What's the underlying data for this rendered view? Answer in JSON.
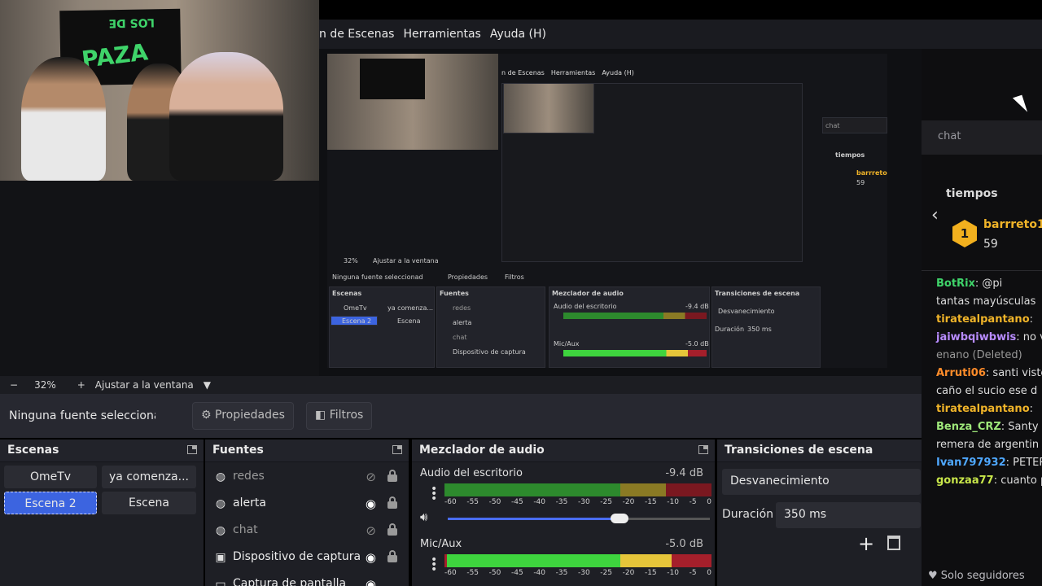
{
  "menu": {
    "items": [
      "n de Escenas",
      "Herramientas",
      "Ayuda (H)"
    ]
  },
  "webcam": {
    "banner_top": "LOS DE",
    "banner_bottom": "PAZA"
  },
  "inner": {
    "menu": [
      "n de Escenas",
      "Herramientas",
      "Ayuda (H)"
    ],
    "zoom": "32%",
    "fit": "Ajustar a la ventana",
    "nosel": "Ninguna fuente seleccionad",
    "props": "Propiedades",
    "filters": "Filtros",
    "scenes_title": "Escenas",
    "sources_title": "Fuentes",
    "mixer_title": "Mezclador de audio",
    "trans_title": "Transiciones de escena",
    "scene_a": "OmeTv",
    "scene_b": "ya comenza...",
    "scene_c": "Escena 2",
    "scene_d": "Escena",
    "src_1": "redes",
    "src_2": "alerta",
    "src_3": "chat",
    "src_4": "Dispositivo de captura",
    "src_5": "Captura de pantalla",
    "mix_1": "Audio del escritorio",
    "mix_1_db": "-9.4 dB",
    "mix_2": "Mic/Aux",
    "mix_2_db": "-5.0 dB",
    "trans": "Desvanecimiento",
    "dur_label": "Duración",
    "dur": "350 ms",
    "chat_input": "chat",
    "tiempos": "tiempos",
    "user": "barrreto1",
    "pts": "59"
  },
  "toolbar": {
    "minus": "−",
    "zoom": "32%",
    "plus": "+",
    "fit": "Ajustar a la ventana",
    "dropdown": "▼"
  },
  "props_bar": {
    "no_selection": "Ninguna fuente seleccionad",
    "properties": "Propiedades",
    "filters": "Filtros"
  },
  "scenes": {
    "title": "Escenas",
    "items": [
      "OmeTv",
      "ya comenza...",
      "Escena 2",
      "Escena"
    ]
  },
  "sources": {
    "title": "Fuentes",
    "items": [
      {
        "label": "redes",
        "icon": "globe-icon"
      },
      {
        "label": "alerta",
        "icon": "globe-icon"
      },
      {
        "label": "chat",
        "icon": "globe-icon"
      },
      {
        "label": "Dispositivo de captura",
        "icon": "camera-icon"
      },
      {
        "label": "Captura de pantalla",
        "icon": "monitor-icon"
      }
    ]
  },
  "mixer": {
    "title": "Mezclador de audio",
    "channels": [
      {
        "name": "Audio del escritorio",
        "db": "-9.4 dB",
        "level": 0.85,
        "volume": 0.66
      },
      {
        "name": "Mic/Aux",
        "db": "-5.0 dB",
        "level": 0.87,
        "volume": 0.7
      }
    ],
    "ticks": [
      "-60",
      "-55",
      "-50",
      "-45",
      "-40",
      "-35",
      "-30",
      "-25",
      "-20",
      "-15",
      "-10",
      "-5",
      "0"
    ]
  },
  "transitions": {
    "title": "Transiciones de escena",
    "selected": "Desvanecimiento",
    "duration_label": "Duración",
    "duration": "350 ms",
    "add": "+"
  },
  "chat": {
    "input_placeholder": "chat",
    "leader_title": "tiempos",
    "leader_rank": "1",
    "leader_user": "barrreto1",
    "leader_points": "59",
    "messages": [
      {
        "user": "BotRix",
        "text": ": @pi",
        "color": "#3fd46a"
      },
      {
        "user": "",
        "text": "tantas mayúsculas",
        "color": "#ddd"
      },
      {
        "user": "tiratealpantano",
        "text": ":",
        "color": "#f0b429"
      },
      {
        "user": "jaiwbqiwbwis",
        "text": ": no v",
        "color": "#b88cff"
      },
      {
        "user": "",
        "text": "enano (Deleted)",
        "color": "#999"
      },
      {
        "user": "Arruti06",
        "text": ": santi viste",
        "color": "#ff8c2a"
      },
      {
        "user": "",
        "text": "caño el sucio ese d",
        "color": "#ddd"
      },
      {
        "user": "tiratealpantano",
        "text": ":",
        "color": "#f0b429"
      },
      {
        "user": "Benza_CRZ",
        "text": ": Santy",
        "color": "#9ee87a"
      },
      {
        "user": "",
        "text": "remera de argentin",
        "color": "#ddd"
      },
      {
        "user": "Ivan797932",
        "text": ": PETER",
        "color": "#4fa8ff"
      },
      {
        "user": "gonzaa77",
        "text": ": cuanto p",
        "color": "#c8e64a"
      }
    ],
    "footer": "Solo seguidores"
  }
}
